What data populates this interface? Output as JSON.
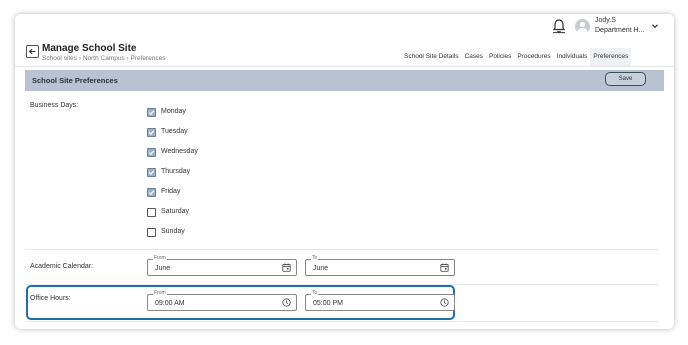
{
  "user": {
    "name": "Jody.S",
    "department": "Department H..."
  },
  "header": {
    "title": "Manage School Site",
    "breadcrumb": "School sites › North Campus › Preferences",
    "tabs": [
      "School Site Details",
      "Cases",
      "Policies",
      "Procedures",
      "Individuals",
      "Preferences"
    ],
    "active_tab": "Preferences"
  },
  "section": {
    "title": "School Site Preferences",
    "save_label": "Save"
  },
  "business_days": {
    "label": "Business Days:",
    "days": [
      {
        "label": "Monday",
        "checked": true
      },
      {
        "label": "Tuesday",
        "checked": true
      },
      {
        "label": "Wednesday",
        "checked": true
      },
      {
        "label": "Thursday",
        "checked": true
      },
      {
        "label": "Friday",
        "checked": true
      },
      {
        "label": "Saturday",
        "checked": false
      },
      {
        "label": "Sunday",
        "checked": false
      }
    ]
  },
  "academic_calendar": {
    "label": "Academic Calendar:",
    "from": {
      "legend": "From",
      "value": "June"
    },
    "to": {
      "legend": "To",
      "value": "June"
    }
  },
  "office_hours": {
    "label": "Office Hours:",
    "from": {
      "legend": "From",
      "value": "09:00 AM"
    },
    "to": {
      "legend": "To",
      "value": "05:00 PM"
    }
  },
  "colors": {
    "section_bar": "#b7c3d0",
    "highlight": "#1f6fa8",
    "checkbox_checked": "#9db0c4"
  }
}
